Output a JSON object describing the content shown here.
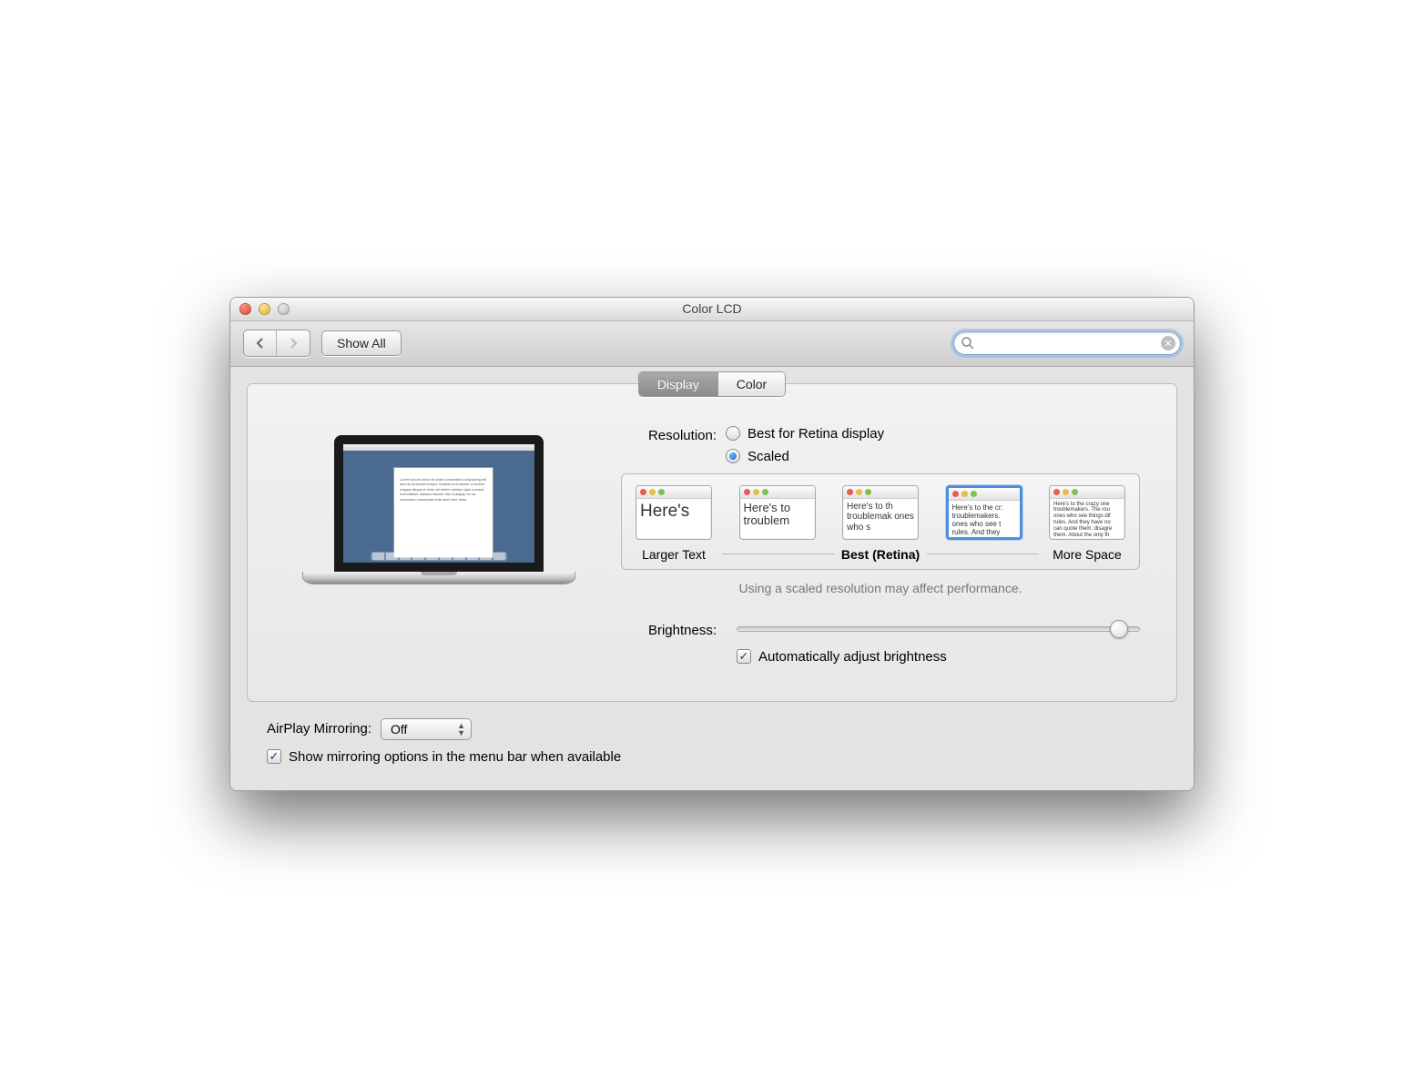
{
  "window": {
    "title": "Color LCD"
  },
  "toolbar": {
    "show_all": "Show All",
    "search_placeholder": ""
  },
  "tabs": {
    "display": "Display",
    "color": "Color",
    "active": "display"
  },
  "resolution": {
    "label": "Resolution:",
    "best": "Best for Retina display",
    "scaled": "Scaled",
    "selected": "scaled"
  },
  "scale": {
    "options": [
      {
        "text": "Here's",
        "font_px": 19
      },
      {
        "text": "Here's to troublem",
        "font_px": 13
      },
      {
        "text": "Here's to th troublemak ones who s",
        "font_px": 10
      },
      {
        "text": "Here's to the cr: troublemakers. ones who see t rules. And they",
        "font_px": 8
      },
      {
        "text": "Here's to the crazy one troublemakers. The rou ones who see things dif rules. And they have no can quote them, disagre them. About the only th Because they change th",
        "font_px": 6
      }
    ],
    "selected_index": 3,
    "left_label": "Larger Text",
    "mid_label": "Best (Retina)",
    "right_label": "More Space",
    "hint": "Using a scaled resolution may affect performance."
  },
  "brightness": {
    "label": "Brightness:",
    "auto_label": "Automatically adjust brightness",
    "auto_checked": true
  },
  "airplay": {
    "label": "AirPlay Mirroring:",
    "value": "Off",
    "show_menu_label": "Show mirroring options in the menu bar when available",
    "show_menu_checked": true
  }
}
